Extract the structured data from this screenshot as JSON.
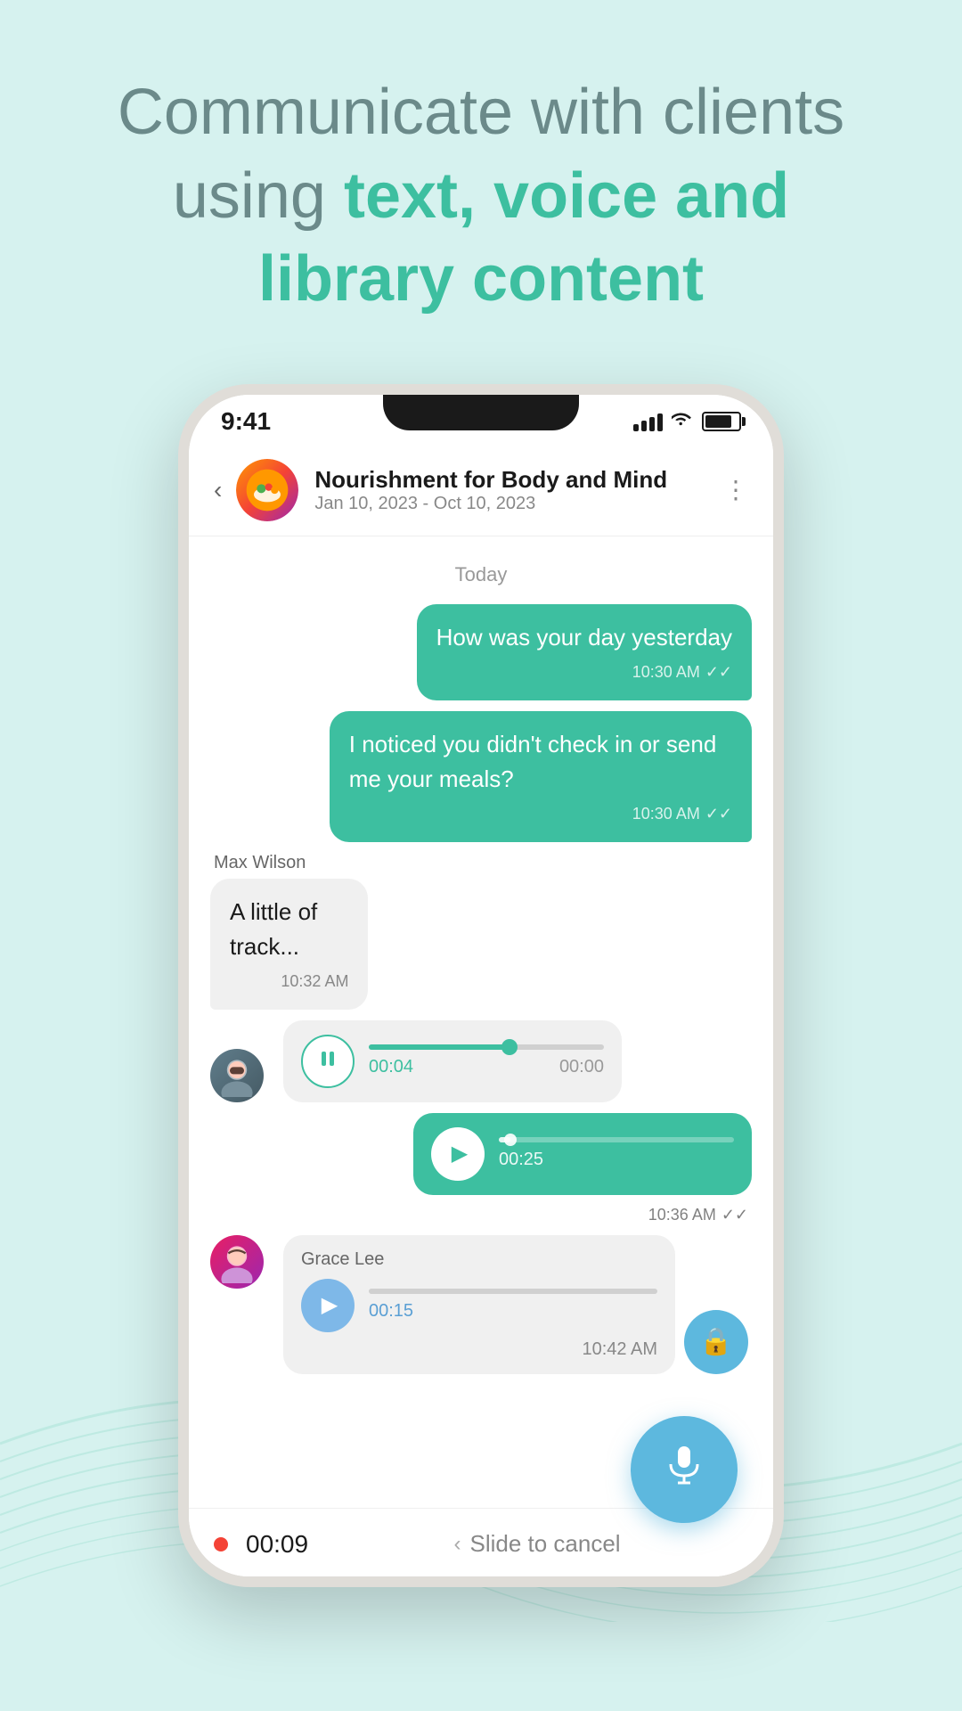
{
  "page": {
    "background_color": "#d6f2ef"
  },
  "header": {
    "line1": "Communicate with clients",
    "line2_plain": "using ",
    "line2_highlight": "text, voice and",
    "line3_highlight": "library content"
  },
  "phone": {
    "status_bar": {
      "time": "9:41",
      "signal": "●●●●",
      "wifi": "wifi",
      "battery": "battery"
    },
    "chat_header": {
      "back_label": "‹",
      "chat_name": "Nourishment for Body and Mind",
      "chat_dates": "Jan 10, 2023 - Oct 10, 2023",
      "more_icon": "⋮"
    },
    "messages": {
      "date_divider": "Today",
      "msg1": {
        "type": "sent",
        "text": "How was your day yesterday",
        "time": "10:30 AM",
        "checks": "✓✓"
      },
      "msg2": {
        "type": "sent",
        "text": "I noticed you didn't check in or send me your meals?",
        "time": "10:30 AM",
        "checks": "✓✓"
      },
      "msg3": {
        "type": "received",
        "sender": "Max Wilson",
        "text": "A little of track...",
        "time": "10:32 AM"
      },
      "voice1": {
        "type": "received_voice",
        "progress_percent": 60,
        "current_time": "00:04",
        "total_time": "00:00",
        "sender": "max"
      },
      "voice2": {
        "type": "sent_voice",
        "progress_percent": 5,
        "current_time": "00:25",
        "total_time": "",
        "time": "10:36 AM",
        "checks": "✓✓"
      },
      "voice3": {
        "type": "received_voice_grace",
        "sender": "Grace Lee",
        "current_time": "00:15",
        "time": "10:42 AM"
      }
    },
    "recording_bar": {
      "dot_color": "#f44336",
      "recording_time": "00:09",
      "slide_text": "Slide to cancel"
    },
    "mic_button": {
      "aria_label": "microphone"
    },
    "lock_button": {
      "aria_label": "lock"
    }
  },
  "icons": {
    "back": "‹",
    "more": "⋮",
    "play": "▶",
    "pause": "⏸",
    "mic": "🎤",
    "lock": "🔒",
    "chevron_left": "‹"
  }
}
